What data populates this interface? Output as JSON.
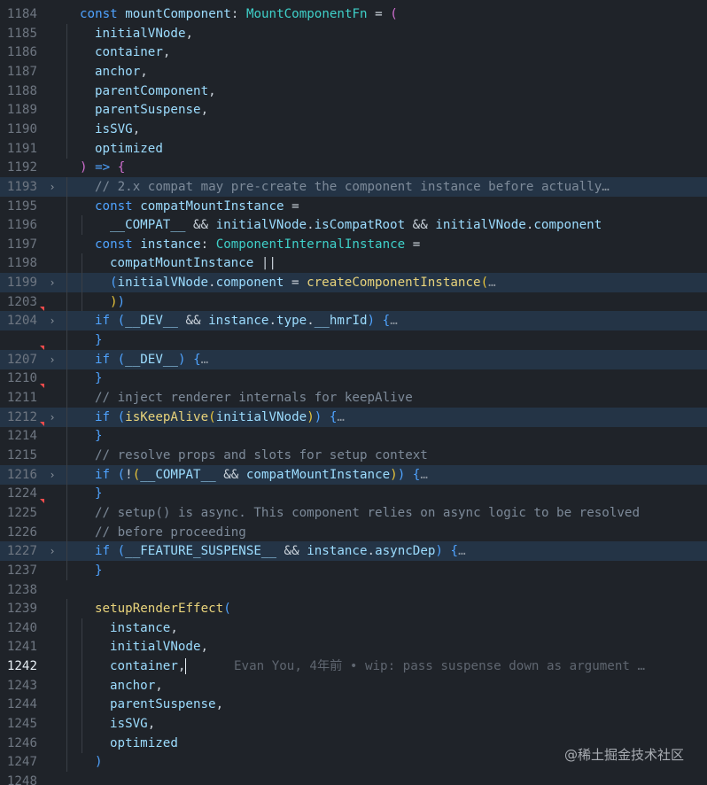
{
  "editor": {
    "lines": [
      {
        "n": "1184",
        "fold": false,
        "mark": false,
        "hl": false,
        "indent": 1,
        "tokens": [
          [
            "kw",
            "const "
          ],
          [
            "va",
            "mountComponent"
          ],
          [
            "op",
            ": "
          ],
          [
            "ty",
            "MountComponentFn"
          ],
          [
            "op",
            " = "
          ],
          [
            "p1",
            "("
          ]
        ]
      },
      {
        "n": "1185",
        "fold": false,
        "mark": false,
        "hl": false,
        "indent": 2,
        "tokens": [
          [
            "va",
            "initialVNode"
          ],
          [
            "op",
            ","
          ]
        ]
      },
      {
        "n": "1186",
        "fold": false,
        "mark": false,
        "hl": false,
        "indent": 2,
        "tokens": [
          [
            "va",
            "container"
          ],
          [
            "op",
            ","
          ]
        ]
      },
      {
        "n": "1187",
        "fold": false,
        "mark": false,
        "hl": false,
        "indent": 2,
        "tokens": [
          [
            "va",
            "anchor"
          ],
          [
            "op",
            ","
          ]
        ]
      },
      {
        "n": "1188",
        "fold": false,
        "mark": false,
        "hl": false,
        "indent": 2,
        "tokens": [
          [
            "va",
            "parentComponent"
          ],
          [
            "op",
            ","
          ]
        ]
      },
      {
        "n": "1189",
        "fold": false,
        "mark": false,
        "hl": false,
        "indent": 2,
        "tokens": [
          [
            "va",
            "parentSuspense"
          ],
          [
            "op",
            ","
          ]
        ]
      },
      {
        "n": "1190",
        "fold": false,
        "mark": false,
        "hl": false,
        "indent": 2,
        "tokens": [
          [
            "va",
            "isSVG"
          ],
          [
            "op",
            ","
          ]
        ]
      },
      {
        "n": "1191",
        "fold": false,
        "mark": false,
        "hl": false,
        "indent": 2,
        "tokens": [
          [
            "va",
            "optimized"
          ]
        ]
      },
      {
        "n": "1192",
        "fold": false,
        "mark": false,
        "hl": false,
        "indent": 1,
        "tokens": [
          [
            "p1",
            ")"
          ],
          [
            "kw",
            " => "
          ],
          [
            "p1",
            "{"
          ]
        ]
      },
      {
        "n": "1193",
        "fold": true,
        "mark": false,
        "hl": true,
        "indent": 2,
        "tokens": [
          [
            "cm",
            "// 2.x compat may pre-create the component instance before actually"
          ],
          [
            "dots",
            "…"
          ]
        ]
      },
      {
        "n": "1195",
        "fold": false,
        "mark": false,
        "hl": false,
        "indent": 2,
        "tokens": [
          [
            "kw",
            "const "
          ],
          [
            "va",
            "compatMountInstance"
          ],
          [
            "op",
            " ="
          ]
        ]
      },
      {
        "n": "1196",
        "fold": false,
        "mark": false,
        "hl": false,
        "indent": 3,
        "tokens": [
          [
            "va",
            "__COMPAT__"
          ],
          [
            "op",
            " && "
          ],
          [
            "va",
            "initialVNode"
          ],
          [
            "op",
            "."
          ],
          [
            "va",
            "isCompatRoot"
          ],
          [
            "op",
            " && "
          ],
          [
            "va",
            "initialVNode"
          ],
          [
            "op",
            "."
          ],
          [
            "va",
            "component"
          ]
        ]
      },
      {
        "n": "1197",
        "fold": false,
        "mark": false,
        "hl": false,
        "indent": 2,
        "tokens": [
          [
            "kw",
            "const "
          ],
          [
            "va",
            "instance"
          ],
          [
            "op",
            ": "
          ],
          [
            "ty",
            "ComponentInternalInstance"
          ],
          [
            "op",
            " ="
          ]
        ]
      },
      {
        "n": "1198",
        "fold": false,
        "mark": false,
        "hl": false,
        "indent": 3,
        "tokens": [
          [
            "va",
            "compatMountInstance"
          ],
          [
            "op",
            " ||"
          ]
        ]
      },
      {
        "n": "1199",
        "fold": true,
        "mark": false,
        "hl": true,
        "indent": 3,
        "tokens": [
          [
            "p2",
            "("
          ],
          [
            "va",
            "initialVNode"
          ],
          [
            "op",
            "."
          ],
          [
            "va",
            "component"
          ],
          [
            "op",
            " = "
          ],
          [
            "fn",
            "createComponentInstance"
          ],
          [
            "p3",
            "("
          ],
          [
            "dots",
            "…"
          ]
        ]
      },
      {
        "n": "1203",
        "fold": false,
        "mark": false,
        "hl": false,
        "indent": 3,
        "tokens": [
          [
            "p3",
            ")"
          ],
          [
            "p2",
            ")"
          ]
        ]
      },
      {
        "n": "1204",
        "fold": true,
        "mark": true,
        "hl": true,
        "indent": 2,
        "tokens": [
          [
            "kw",
            "if "
          ],
          [
            "p2",
            "("
          ],
          [
            "va",
            "__DEV__"
          ],
          [
            "op",
            " && "
          ],
          [
            "va",
            "instance"
          ],
          [
            "op",
            "."
          ],
          [
            "va",
            "type"
          ],
          [
            "op",
            "."
          ],
          [
            "va",
            "__hmrId"
          ],
          [
            "p2",
            ")"
          ],
          [
            "op",
            " "
          ],
          [
            "p2",
            "{"
          ],
          [
            "dots",
            "…"
          ]
        ]
      },
      {
        "n": "",
        "fold": false,
        "mark": false,
        "hl": false,
        "indent": 2,
        "tokens": [
          [
            "p2",
            "}"
          ]
        ]
      },
      {
        "n": "1207",
        "fold": true,
        "mark": true,
        "hl": true,
        "indent": 2,
        "tokens": [
          [
            "kw",
            "if "
          ],
          [
            "p2",
            "("
          ],
          [
            "va",
            "__DEV__"
          ],
          [
            "p2",
            ")"
          ],
          [
            "op",
            " "
          ],
          [
            "p2",
            "{"
          ],
          [
            "dots",
            "…"
          ]
        ]
      },
      {
        "n": "1210",
        "fold": false,
        "mark": false,
        "hl": false,
        "indent": 2,
        "tokens": [
          [
            "p2",
            "}"
          ]
        ]
      },
      {
        "n": "1211",
        "fold": false,
        "mark": true,
        "hl": false,
        "indent": 2,
        "tokens": [
          [
            "cm",
            "// inject renderer internals for keepAlive"
          ]
        ]
      },
      {
        "n": "1212",
        "fold": true,
        "mark": false,
        "hl": true,
        "indent": 2,
        "tokens": [
          [
            "kw",
            "if "
          ],
          [
            "p2",
            "("
          ],
          [
            "fn",
            "isKeepAlive"
          ],
          [
            "p3",
            "("
          ],
          [
            "va",
            "initialVNode"
          ],
          [
            "p3",
            ")"
          ],
          [
            "p2",
            ")"
          ],
          [
            "op",
            " "
          ],
          [
            "p2",
            "{"
          ],
          [
            "dots",
            "…"
          ]
        ]
      },
      {
        "n": "1214",
        "fold": false,
        "mark": true,
        "hl": false,
        "indent": 2,
        "tokens": [
          [
            "p2",
            "}"
          ]
        ]
      },
      {
        "n": "1215",
        "fold": false,
        "mark": false,
        "hl": false,
        "indent": 2,
        "tokens": [
          [
            "cm",
            "// resolve props and slots for setup context"
          ]
        ]
      },
      {
        "n": "1216",
        "fold": true,
        "mark": false,
        "hl": true,
        "indent": 2,
        "tokens": [
          [
            "kw",
            "if "
          ],
          [
            "p2",
            "("
          ],
          [
            "op",
            "!"
          ],
          [
            "p3",
            "("
          ],
          [
            "va",
            "__COMPAT__"
          ],
          [
            "op",
            " && "
          ],
          [
            "va",
            "compatMountInstance"
          ],
          [
            "p3",
            ")"
          ],
          [
            "p2",
            ")"
          ],
          [
            "op",
            " "
          ],
          [
            "p2",
            "{"
          ],
          [
            "dots",
            "…"
          ]
        ]
      },
      {
        "n": "1224",
        "fold": false,
        "mark": false,
        "hl": false,
        "indent": 2,
        "tokens": [
          [
            "p2",
            "}"
          ]
        ]
      },
      {
        "n": "1225",
        "fold": false,
        "mark": true,
        "hl": false,
        "indent": 2,
        "tokens": [
          [
            "cm",
            "// setup() is async. This component relies on async logic to be resolved"
          ]
        ]
      },
      {
        "n": "1226",
        "fold": false,
        "mark": false,
        "hl": false,
        "indent": 2,
        "tokens": [
          [
            "cm",
            "// before proceeding"
          ]
        ]
      },
      {
        "n": "1227",
        "fold": true,
        "mark": false,
        "hl": true,
        "indent": 2,
        "tokens": [
          [
            "kw",
            "if "
          ],
          [
            "p2",
            "("
          ],
          [
            "va",
            "__FEATURE_SUSPENSE__"
          ],
          [
            "op",
            " && "
          ],
          [
            "va",
            "instance"
          ],
          [
            "op",
            "."
          ],
          [
            "va",
            "asyncDep"
          ],
          [
            "p2",
            ")"
          ],
          [
            "op",
            " "
          ],
          [
            "p2",
            "{"
          ],
          [
            "dots",
            "…"
          ]
        ]
      },
      {
        "n": "1237",
        "fold": false,
        "mark": false,
        "hl": false,
        "indent": 2,
        "tokens": [
          [
            "p2",
            "}"
          ]
        ]
      },
      {
        "n": "1238",
        "fold": false,
        "mark": false,
        "hl": false,
        "indent": 1,
        "tokens": []
      },
      {
        "n": "1239",
        "fold": false,
        "mark": false,
        "hl": false,
        "indent": 2,
        "tokens": [
          [
            "fn",
            "setupRenderEffect"
          ],
          [
            "p2",
            "("
          ]
        ]
      },
      {
        "n": "1240",
        "fold": false,
        "mark": false,
        "hl": false,
        "indent": 3,
        "tokens": [
          [
            "va",
            "instance"
          ],
          [
            "op",
            ","
          ]
        ]
      },
      {
        "n": "1241",
        "fold": false,
        "mark": false,
        "hl": false,
        "indent": 3,
        "tokens": [
          [
            "va",
            "initialVNode"
          ],
          [
            "op",
            ","
          ]
        ]
      },
      {
        "n": "1242",
        "fold": false,
        "mark": false,
        "hl": false,
        "cur": true,
        "indent": 3,
        "tokens": [
          [
            "va",
            "container"
          ],
          [
            "op",
            ","
          ]
        ]
      },
      {
        "n": "1243",
        "fold": false,
        "mark": false,
        "hl": false,
        "indent": 3,
        "tokens": [
          [
            "va",
            "anchor"
          ],
          [
            "op",
            ","
          ]
        ]
      },
      {
        "n": "1244",
        "fold": false,
        "mark": false,
        "hl": false,
        "indent": 3,
        "tokens": [
          [
            "va",
            "parentSuspense"
          ],
          [
            "op",
            ","
          ]
        ]
      },
      {
        "n": "1245",
        "fold": false,
        "mark": false,
        "hl": false,
        "indent": 3,
        "tokens": [
          [
            "va",
            "isSVG"
          ],
          [
            "op",
            ","
          ]
        ]
      },
      {
        "n": "1246",
        "fold": false,
        "mark": false,
        "hl": false,
        "indent": 3,
        "tokens": [
          [
            "va",
            "optimized"
          ]
        ]
      },
      {
        "n": "1247",
        "fold": false,
        "mark": false,
        "hl": false,
        "indent": 2,
        "tokens": [
          [
            "p2",
            ")"
          ]
        ]
      },
      {
        "n": "1248",
        "fold": false,
        "mark": false,
        "hl": false,
        "indent": 1,
        "tokens": []
      }
    ],
    "blame": "Evan You, 4年前 • wip: pass suspense down as argument …"
  },
  "watermark": "@稀土掘金技术社区",
  "colors": {
    "background": "#1f2329",
    "highlight": "#243446",
    "keyword": "#4fa3ff",
    "type": "#3fd0c9",
    "function": "#e8d37b",
    "variable": "#9cdcfe",
    "comment": "#7d8a99",
    "bracket1": "#d16fd1",
    "bracket2": "#4fa3ff",
    "bracket3": "#e8c43a",
    "gutter_mark": "#f14c4c"
  }
}
